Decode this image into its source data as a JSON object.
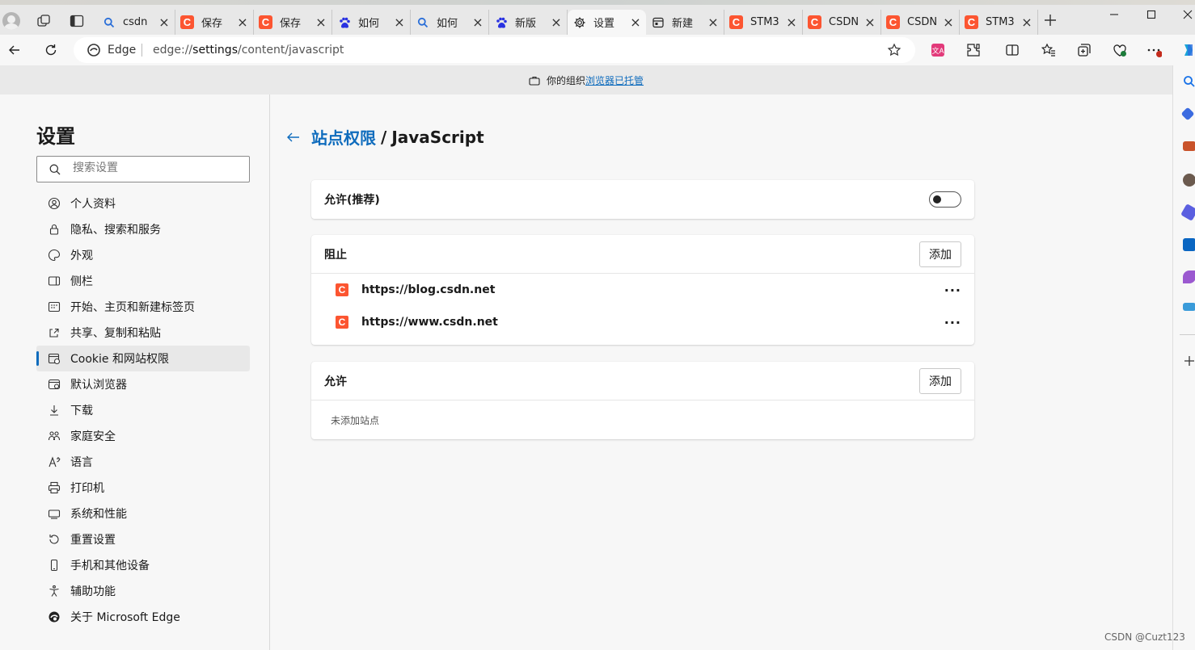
{
  "tabs": [
    {
      "title": "csdn",
      "favicon": "search-icon",
      "active": false
    },
    {
      "title": "保存",
      "favicon": "csdn-icon",
      "active": false
    },
    {
      "title": "保存",
      "favicon": "csdn-icon",
      "active": false
    },
    {
      "title": "如何",
      "favicon": "baidu-paw-icon",
      "active": false
    },
    {
      "title": "如何",
      "favicon": "search-icon",
      "active": false
    },
    {
      "title": "新版",
      "favicon": "baidu-paw-icon",
      "active": false
    },
    {
      "title": "设置",
      "favicon": "gear-icon",
      "active": true
    },
    {
      "title": "新建",
      "favicon": "newtab-icon",
      "active": false
    },
    {
      "title": "STM3",
      "favicon": "csdn-icon",
      "active": false
    },
    {
      "title": "CSDN",
      "favicon": "csdn-icon",
      "active": false
    },
    {
      "title": "CSDN",
      "favicon": "csdn-icon",
      "active": false
    },
    {
      "title": "STM3",
      "favicon": "csdn-icon",
      "active": false
    }
  ],
  "address": {
    "brand": "Edge",
    "url_prefix": "edge://",
    "url_host": "settings",
    "url_path": "/content/javascript"
  },
  "managed_bar": {
    "text": "你的组织",
    "link": "浏览器已托管"
  },
  "sidebar": {
    "title": "设置",
    "search_placeholder": "搜索设置",
    "items": [
      {
        "label": "个人资料",
        "icon": "profile-icon"
      },
      {
        "label": "隐私、搜索和服务",
        "icon": "lock-icon"
      },
      {
        "label": "外观",
        "icon": "palette-icon"
      },
      {
        "label": "侧栏",
        "icon": "sidebar-icon"
      },
      {
        "label": "开始、主页和新建标签页",
        "icon": "home-grid-icon"
      },
      {
        "label": "共享、复制和粘贴",
        "icon": "share-icon"
      },
      {
        "label": "Cookie 和网站权限",
        "icon": "cookie-site-icon",
        "active": true
      },
      {
        "label": "默认浏览器",
        "icon": "browser-icon"
      },
      {
        "label": "下载",
        "icon": "download-icon"
      },
      {
        "label": "家庭安全",
        "icon": "family-icon"
      },
      {
        "label": "语言",
        "icon": "language-icon"
      },
      {
        "label": "打印机",
        "icon": "printer-icon"
      },
      {
        "label": "系统和性能",
        "icon": "system-icon"
      },
      {
        "label": "重置设置",
        "icon": "reset-icon"
      },
      {
        "label": "手机和其他设备",
        "icon": "phone-icon"
      },
      {
        "label": "辅助功能",
        "icon": "accessibility-icon"
      },
      {
        "label": "关于 Microsoft Edge",
        "icon": "edge-logo-icon"
      }
    ]
  },
  "page": {
    "breadcrumb_link": "站点权限",
    "breadcrumb_sep": "/",
    "breadcrumb_current": "JavaScript",
    "allow_recommended": "允许(推荐)",
    "allow_toggle_on": false,
    "block_section": "阻止",
    "add_label": "添加",
    "blocked_sites": [
      "https://blog.csdn.net",
      "https://www.csdn.net"
    ],
    "more_label": "···",
    "allow_section": "允许",
    "allow_empty": "未添加站点"
  },
  "watermark": "CSDN @Cuzt123",
  "colors": {
    "accent": "#0f6cbd",
    "csdn": "#fc5531"
  }
}
